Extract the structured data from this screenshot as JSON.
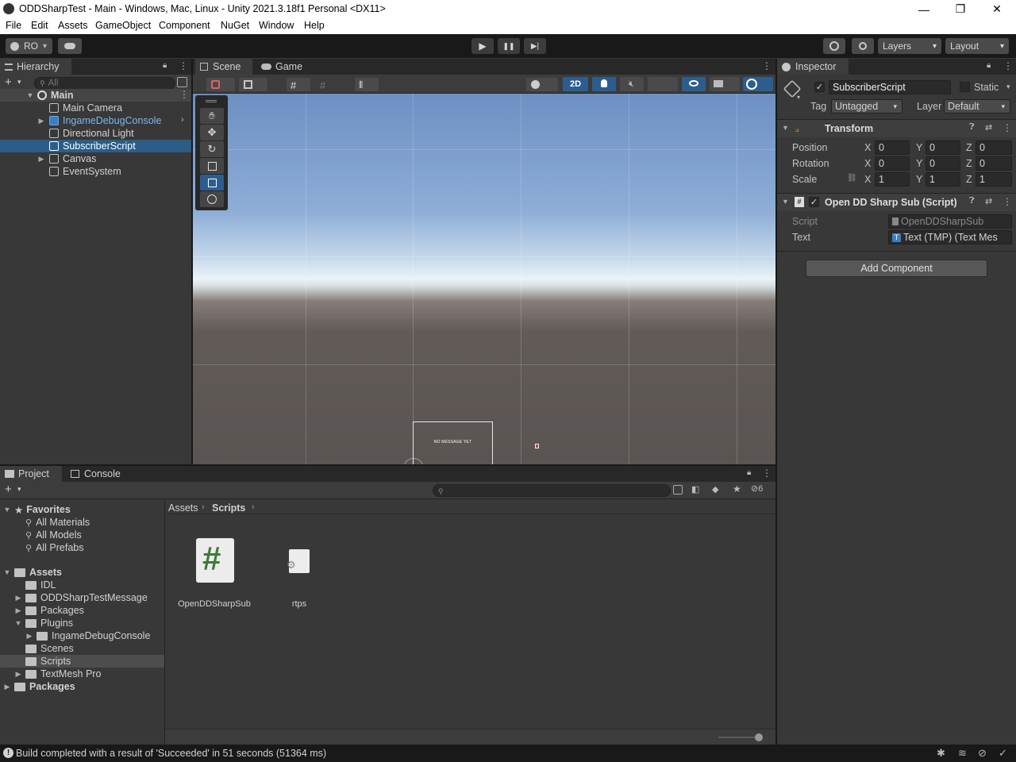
{
  "window": {
    "title": "ODDSharpTest - Main - Windows, Mac, Linux - Unity 2021.3.18f1 Personal <DX11>",
    "minimize": "—",
    "maximize": "❐",
    "close": "✕"
  },
  "menu": [
    "File",
    "Edit",
    "Assets",
    "GameObject",
    "Component",
    "NuGet",
    "Window",
    "Help"
  ],
  "toolbar": {
    "account": "RO",
    "play": "▶",
    "pause": "❚❚",
    "step": "▶|",
    "layers": "Layers",
    "layout": "Layout"
  },
  "hierarchy": {
    "tab": "Hierarchy",
    "search_placeholder": "All",
    "scene": "Main",
    "items": [
      {
        "label": "Main Camera"
      },
      {
        "label": "IngameDebugConsole"
      },
      {
        "label": "Directional Light"
      },
      {
        "label": "SubscriberScript"
      },
      {
        "label": "Canvas"
      },
      {
        "label": "EventSystem"
      }
    ]
  },
  "scene": {
    "tab_scene": "Scene",
    "tab_game": "Game",
    "mode_2d": "2D",
    "canvas_text": "NO MESSAGE YET"
  },
  "inspector": {
    "tab": "Inspector",
    "object_name": "SubscriberScript",
    "static_label": "Static",
    "tag_label": "Tag",
    "tag_value": "Untagged",
    "layer_label": "Layer",
    "layer_value": "Default",
    "transform": {
      "title": "Transform",
      "position_label": "Position",
      "rotation_label": "Rotation",
      "scale_label": "Scale",
      "position": [
        "0",
        "0",
        "0"
      ],
      "rotation": [
        "0",
        "0",
        "0"
      ],
      "scale": [
        "1",
        "1",
        "1"
      ],
      "x": "X",
      "y": "Y",
      "z": "Z"
    },
    "script_component": {
      "title": "Open DD Sharp Sub (Script)",
      "script_label": "Script",
      "script_value": "OpenDDSharpSub",
      "text_label": "Text",
      "text_value": "Text (TMP) (Text Mes"
    },
    "add_component": "Add Component"
  },
  "project": {
    "tab_project": "Project",
    "tab_console": "Console",
    "hidden_count": "6",
    "favorites_label": "Favorites",
    "favorites": [
      "All Materials",
      "All Models",
      "All Prefabs"
    ],
    "assets_label": "Assets",
    "tree": [
      {
        "label": "IDL"
      },
      {
        "label": "ODDSharpTestMessage"
      },
      {
        "label": "Packages"
      },
      {
        "label": "Plugins"
      },
      {
        "label": "IngameDebugConsole"
      },
      {
        "label": "Scenes"
      },
      {
        "label": "Scripts"
      },
      {
        "label": "TextMesh Pro"
      }
    ],
    "packages_label": "Packages",
    "breadcrumb_assets": "Assets",
    "breadcrumb_scripts": "Scripts",
    "files": [
      {
        "name": "OpenDDSharpSub"
      },
      {
        "name": "rtps"
      }
    ]
  },
  "status": {
    "message": "Build completed with a result of 'Succeeded' in 51 seconds (51364 ms)"
  }
}
